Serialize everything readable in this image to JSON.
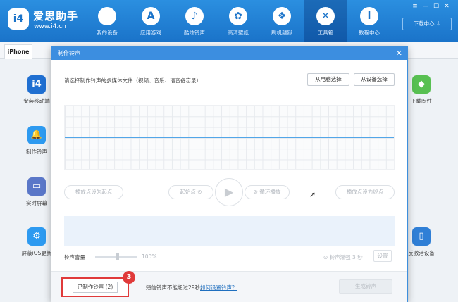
{
  "brand": {
    "logo_text": "i4",
    "name": "爱思助手",
    "url": "www.i4.cn"
  },
  "nav": [
    {
      "label": "我的设备",
      "icon": "apple-icon",
      "glyph": "",
      "active": false
    },
    {
      "label": "应用游戏",
      "icon": "app-store-icon",
      "glyph": "A",
      "active": false
    },
    {
      "label": "酷炫铃声",
      "icon": "bell-icon",
      "glyph": "♪",
      "active": false
    },
    {
      "label": "高清壁纸",
      "icon": "flower-icon",
      "glyph": "✿",
      "active": false
    },
    {
      "label": "刷机越狱",
      "icon": "dropbox-icon",
      "glyph": "❖",
      "active": false
    },
    {
      "label": "工具箱",
      "icon": "tools-icon",
      "glyph": "✕",
      "active": true
    },
    {
      "label": "教程中心",
      "icon": "info-icon",
      "glyph": "i",
      "active": false
    }
  ],
  "window_controls": {
    "menu": "≡",
    "minimize": "—",
    "maximize": "☐",
    "close": "✕"
  },
  "download_center": "下载中心 ⇩",
  "device_tab": "iPhone",
  "tools": {
    "left": [
      {
        "label": "安装移动端",
        "glyph": "i4",
        "color": "#1f6fd1"
      },
      {
        "label": "制作铃声",
        "glyph": "🔔",
        "color": "#2d9af0"
      },
      {
        "label": "实时屏幕",
        "glyph": "▭",
        "color": "#5a77c8"
      },
      {
        "label": "屏蔽iOS更新",
        "glyph": "⚙",
        "color": "#2d9af0"
      }
    ],
    "right": [
      {
        "label": "下载固件",
        "glyph": "◆",
        "color": "#58c052"
      },
      {
        "label": "反激活设备",
        "glyph": "▯",
        "color": "#2f7fd6"
      }
    ]
  },
  "dialog": {
    "title": "制作铃声",
    "close": "✕",
    "prompt": "请选择制作铃声的多媒体文件（视频、音乐、语音备忘录）",
    "from_computer": "从电脑选择",
    "from_device": "从设备选择",
    "set_start": "播放点设为起点",
    "start_point": "起始点 ⊙",
    "play": "▶",
    "loop_play": "⊘ 循环播放",
    "set_end": "播放点设为终点",
    "volume_label": "铃声音量",
    "volume_value": "100%",
    "loop_interval": "⊙ 铃声渐强 3 秒",
    "settings": "设置",
    "made_ringtones": "已制作铃声 (2)",
    "step_number": "3",
    "hint": "短信铃声不能超过29秒。",
    "howto": "如何设置铃声？",
    "generate": "生成铃声"
  }
}
